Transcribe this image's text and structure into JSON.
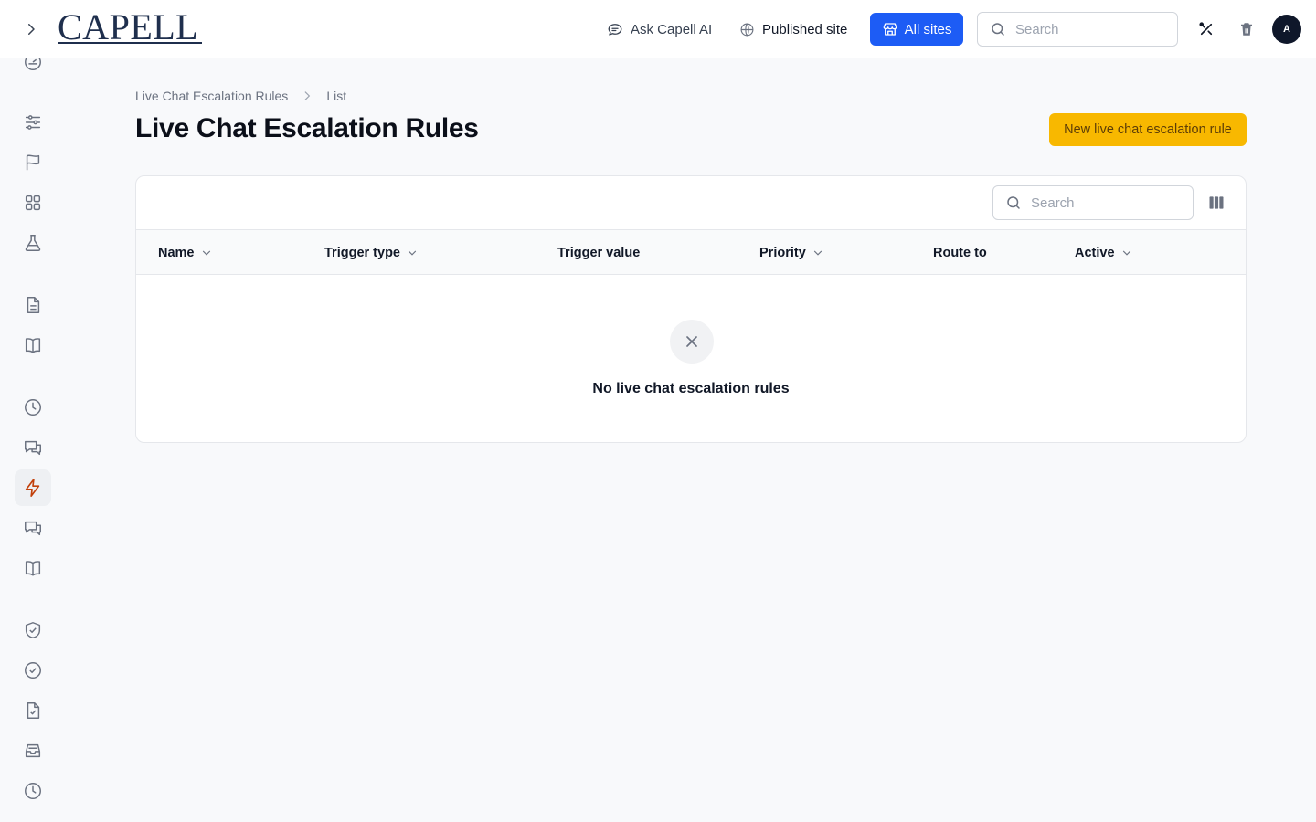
{
  "header": {
    "logo_text": "CAPELL",
    "ask_ai_label": "Ask Capell AI",
    "published_site_label": "Published site",
    "all_sites_label": "All sites",
    "search_placeholder": "Search",
    "avatar_initial": "A"
  },
  "sidebar": {
    "items": [
      {
        "icon": "dashboard-icon"
      },
      {
        "icon": "sliders-icon"
      },
      {
        "icon": "flag-icon"
      },
      {
        "icon": "grid-icon"
      },
      {
        "icon": "flask-icon"
      },
      {
        "icon": "document-icon"
      },
      {
        "icon": "book-icon"
      },
      {
        "icon": "clock-icon"
      },
      {
        "icon": "chat-bubbles-icon"
      },
      {
        "icon": "bolt-icon",
        "active": true
      },
      {
        "icon": "chat-bubbles-icon"
      },
      {
        "icon": "book-icon"
      },
      {
        "icon": "shield-check-icon"
      },
      {
        "icon": "check-circle-icon"
      },
      {
        "icon": "document-check-icon"
      },
      {
        "icon": "inbox-icon"
      },
      {
        "icon": "clock-icon"
      }
    ],
    "active_color": "#c2410c"
  },
  "breadcrumb": {
    "items": [
      "Live Chat Escalation Rules",
      "List"
    ]
  },
  "page": {
    "title": "Live Chat Escalation Rules",
    "new_button_label": "New live chat escalation rule"
  },
  "table": {
    "search_placeholder": "Search",
    "columns": [
      {
        "label": "Name",
        "sortable": true
      },
      {
        "label": "Trigger type",
        "sortable": true
      },
      {
        "label": "Trigger value",
        "sortable": false
      },
      {
        "label": "Priority",
        "sortable": true
      },
      {
        "label": "Route to",
        "sortable": false
      },
      {
        "label": "Active",
        "sortable": true
      }
    ],
    "empty_message": "No live chat escalation rules"
  },
  "colors": {
    "primary_blue": "#1d5cf5",
    "accent_yellow": "#f8b800"
  }
}
